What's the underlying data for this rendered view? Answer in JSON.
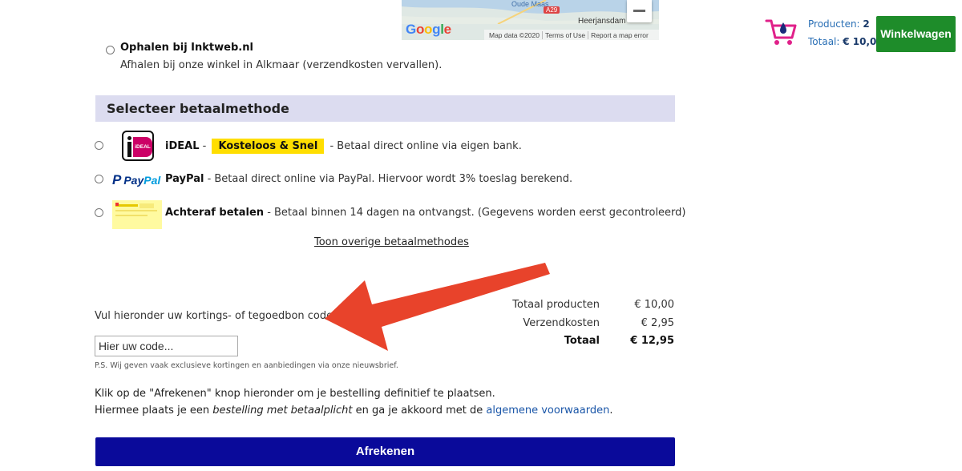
{
  "map": {
    "brand": "Google",
    "place_top": "Oude Maas",
    "place_right": "Heerjansdam",
    "road_badge": "A29",
    "footer": [
      "Map data ©2020",
      "Terms of Use",
      "Report a map error"
    ]
  },
  "shipping": {
    "pickup_title": "Ophalen bij Inktweb.nl",
    "pickup_desc": "Afhalen bij onze winkel in Alkmaar (verzendkosten vervallen)."
  },
  "payment": {
    "header": "Selecteer betaalmethode",
    "ideal": {
      "name": "iDEAL",
      "sep": " - ",
      "badge": "Kosteloos & Snel",
      "desc": " - Betaal direct online via eigen bank.",
      "logo_text": "iDEAL"
    },
    "paypal": {
      "name": "PayPal",
      "desc": " - Betaal direct online via PayPal. Hiervoor wordt 3% toeslag berekend.",
      "logo_pay": "Pay",
      "logo_pal": "Pal"
    },
    "achteraf": {
      "name": "Achteraf betalen",
      "desc": " - Betaal binnen 14 dagen na ontvangst. (Gegevens worden eerst gecontroleerd)"
    },
    "more_link": "Toon overige betaalmethodes"
  },
  "discount": {
    "label": "Vul hieronder uw kortings- of tegoedbon code in.",
    "placeholder": "Hier uw code...",
    "note": "P.S. Wij geven vaak exclusieve kortingen en aanbiedingen via onze nieuwsbrief."
  },
  "totals": {
    "products_label": "Totaal producten",
    "products_value": "€ 10,00",
    "shipping_label": "Verzendkosten",
    "shipping_value": "€ 2,95",
    "total_label": "Totaal",
    "total_value": "€ 12,95"
  },
  "checkout": {
    "line1": "Klik op de \"Afrekenen\" knop hieronder om je bestelling definitief te plaatsen.",
    "line2_a": "Hiermee plaats je een ",
    "line2_em": "bestelling met betaalplicht",
    "line2_b": " en ga je akkoord met de ",
    "terms_link": "algemene voorwaarden",
    "line2_end": ".",
    "button": "Afrekenen"
  },
  "cart": {
    "products_label": "Producten: ",
    "products_count": "2",
    "total_label": "Totaal: ",
    "total_value": "€ 10,00",
    "button": "Winkelwagen"
  },
  "colors": {
    "header_bg": "#dcdcf0",
    "badge": "#ffde00",
    "checkout_button": "#0a0a9a",
    "cart_button": "#1e8c2a",
    "link": "#1a56a8",
    "arrow": "#e8432b"
  }
}
